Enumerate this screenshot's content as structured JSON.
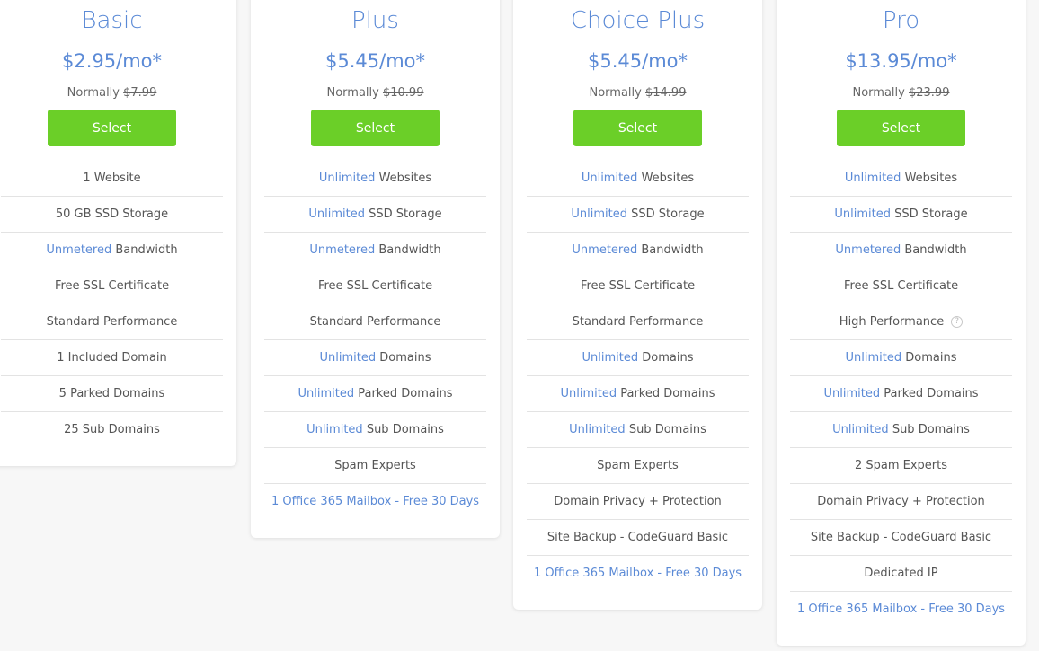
{
  "select_label": "Select",
  "normally_label": "Normally",
  "colors": {
    "accent": "#5b8ad6",
    "button": "#6bcf28",
    "page_bg": "#f7f7f7"
  },
  "plans": [
    {
      "name": "Basic",
      "price": "$2.95/mo*",
      "normal_price": "$7.99",
      "features": [
        {
          "hl": "",
          "text": "1 Website"
        },
        {
          "hl": "",
          "text": "50 GB SSD Storage"
        },
        {
          "hl": "Unmetered",
          "text": " Bandwidth"
        },
        {
          "hl": "",
          "text": "Free SSL Certificate"
        },
        {
          "hl": "",
          "text": "Standard Performance"
        },
        {
          "hl": "",
          "text": "1 Included Domain"
        },
        {
          "hl": "",
          "text": "5 Parked Domains"
        },
        {
          "hl": "",
          "text": "25 Sub Domains"
        }
      ]
    },
    {
      "name": "Plus",
      "price": "$5.45/mo*",
      "normal_price": "$10.99",
      "features": [
        {
          "hl": "Unlimited",
          "text": " Websites"
        },
        {
          "hl": "Unlimited",
          "text": " SSD Storage"
        },
        {
          "hl": "Unmetered",
          "text": " Bandwidth"
        },
        {
          "hl": "",
          "text": "Free SSL Certificate"
        },
        {
          "hl": "",
          "text": "Standard Performance"
        },
        {
          "hl": "Unlimited",
          "text": " Domains"
        },
        {
          "hl": "Unlimited",
          "text": " Parked Domains"
        },
        {
          "hl": "Unlimited",
          "text": " Sub Domains"
        },
        {
          "hl": "",
          "text": "Spam Experts"
        },
        {
          "link": "1 Office 365 Mailbox - Free 30 Days"
        }
      ]
    },
    {
      "name": "Choice Plus",
      "price": "$5.45/mo*",
      "normal_price": "$14.99",
      "features": [
        {
          "hl": "Unlimited",
          "text": " Websites"
        },
        {
          "hl": "Unlimited",
          "text": " SSD Storage"
        },
        {
          "hl": "Unmetered",
          "text": " Bandwidth"
        },
        {
          "hl": "",
          "text": "Free SSL Certificate"
        },
        {
          "hl": "",
          "text": "Standard Performance"
        },
        {
          "hl": "Unlimited",
          "text": " Domains"
        },
        {
          "hl": "Unlimited",
          "text": " Parked Domains"
        },
        {
          "hl": "Unlimited",
          "text": " Sub Domains"
        },
        {
          "hl": "",
          "text": "Spam Experts"
        },
        {
          "hl": "",
          "text": "Domain Privacy + Protection"
        },
        {
          "hl": "",
          "text": "Site Backup - CodeGuard Basic"
        },
        {
          "link": "1 Office 365 Mailbox - Free 30 Days"
        }
      ]
    },
    {
      "name": "Pro",
      "price": "$13.95/mo*",
      "normal_price": "$23.99",
      "features": [
        {
          "hl": "Unlimited",
          "text": " Websites"
        },
        {
          "hl": "Unlimited",
          "text": " SSD Storage"
        },
        {
          "hl": "Unmetered",
          "text": " Bandwidth"
        },
        {
          "hl": "",
          "text": "Free SSL Certificate"
        },
        {
          "hl": "",
          "text": "High Performance",
          "help": "?"
        },
        {
          "hl": "Unlimited",
          "text": " Domains"
        },
        {
          "hl": "Unlimited",
          "text": " Parked Domains"
        },
        {
          "hl": "Unlimited",
          "text": " Sub Domains"
        },
        {
          "hl": "",
          "text": "2 Spam Experts"
        },
        {
          "hl": "",
          "text": "Domain Privacy + Protection"
        },
        {
          "hl": "",
          "text": "Site Backup - CodeGuard Basic"
        },
        {
          "hl": "",
          "text": "Dedicated IP"
        },
        {
          "link": "1 Office 365 Mailbox - Free 30 Days"
        }
      ]
    }
  ]
}
